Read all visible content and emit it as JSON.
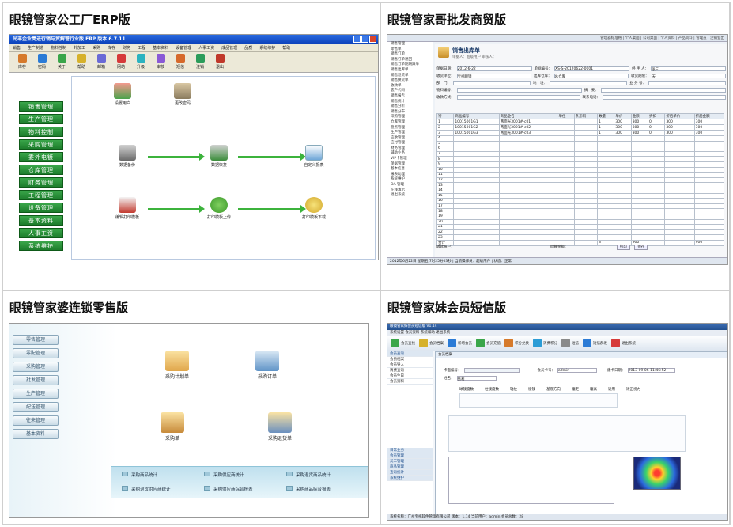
{
  "cells": [
    {
      "title": "眼镜管家公工厂ERP版"
    },
    {
      "title": "眼镜管家哥批发商贸版"
    },
    {
      "title": "眼镜管家婆连锁零售版"
    },
    {
      "title": "眼镜管家妹会员短信版"
    }
  ],
  "erp": {
    "window_title": "光丰企业亮进行销与贸解管行业版 ERP 版本 6.7.11",
    "menu": [
      "销售",
      "生产制造",
      "物料控制",
      "外加工",
      "采购",
      "库存",
      "财务",
      "工程",
      "基本资料",
      "设备管理",
      "人事工资",
      "成品管理",
      "品质",
      "系统维护",
      "帮助"
    ],
    "toolbar": [
      "库存",
      "密码",
      "关于",
      "帮助",
      "邮箱",
      "网站",
      "升级",
      "审核",
      "短信",
      "注销",
      "退出"
    ],
    "side": [
      "销售管理",
      "生产管理",
      "物料控制",
      "采购管理",
      "委外电镀",
      "仓库管理",
      "财务管理",
      "工程管理",
      "设备管理",
      "基本资料",
      "人事工资",
      "系统维护"
    ],
    "nodes": {
      "users": "设置用户",
      "password": "更改密码",
      "backup": "数据备份",
      "restore": "数据恢复",
      "report": "自定义报表",
      "print_template": "编辑打印模板",
      "upload": "打印模板上传",
      "download": "打印模板下载"
    }
  },
  "ws": {
    "topbar": "管理器标准格 | 个人桌面 | 公司桌面 | 个人资料 | 产品资料 | 管理员 | 注销登出",
    "tree": [
      "销售管理",
      "零售单",
      "销售订单",
      "销售订单退回",
      "销售订单期期跟单",
      "销售出库单",
      "销售退货单",
      "销售换货单",
      "收款单",
      "客户代码",
      "销售报告",
      "销售统计",
      "销售分析",
      "销售分布",
      "采购管理",
      "仓库管理",
      "盘点管理",
      "生产管理",
      "应收管理",
      "应付管理",
      "财务管理",
      "辅助业务",
      "VIP卡管理",
      "单据管理",
      "基本信息",
      "报表助理",
      "系统维护",
      "OA 管理",
      "在线演示",
      "退出系统"
    ],
    "form_title": "销售出库单",
    "form_hint": "单据人：超级用户  审核人：",
    "fields": {
      "date_label": "单据日期：",
      "date": "2012-6-22",
      "customer_label": "收货单位：",
      "customer": "宝视眼镜",
      "dept_label": "部　门：",
      "phone_label": "联系电话：",
      "number_label": "单据编号：",
      "number": "XS-S-20120622-0001",
      "warehouse_label": "出库仓库：",
      "warehouse": "总仓库",
      "address_label": "地　址：",
      "memo_label": "摘　要：",
      "handler_label": "经 手 人：",
      "handler": "张三",
      "receive_label": "收货期限：",
      "receive": "天",
      "seller_label": "业 务 号：",
      "type_label": "物料编号：",
      "pay_label": "收款方式："
    },
    "columns": [
      "行",
      "商品编号",
      "商品全名",
      "单位",
      "条形码",
      "数量",
      "单价",
      "金额",
      "折扣",
      "折后单价",
      "折后金额"
    ],
    "rows": [
      [
        "1",
        "10015001G1",
        "两面光3001#-c01",
        "",
        "",
        "1",
        "300",
        "300",
        "0",
        "300",
        "300"
      ],
      [
        "2",
        "10015001G2",
        "两面光3001#-c02",
        "",
        "",
        "1",
        "300",
        "300",
        "0",
        "300",
        "300"
      ],
      [
        "3",
        "10015001G3",
        "两面光3001#-c03",
        "",
        "",
        "1",
        "300",
        "300",
        "0",
        "300",
        "300"
      ],
      [
        "4",
        "",
        "",
        "",
        "",
        "",
        "",
        "",
        "",
        "",
        ""
      ],
      [
        "5",
        "",
        "",
        "",
        "",
        "",
        "",
        "",
        "",
        "",
        ""
      ],
      [
        "6",
        "",
        "",
        "",
        "",
        "",
        "",
        "",
        "",
        "",
        ""
      ],
      [
        "7",
        "",
        "",
        "",
        "",
        "",
        "",
        "",
        "",
        "",
        ""
      ],
      [
        "8",
        "",
        "",
        "",
        "",
        "",
        "",
        "",
        "",
        "",
        ""
      ],
      [
        "9",
        "",
        "",
        "",
        "",
        "",
        "",
        "",
        "",
        "",
        ""
      ],
      [
        "10",
        "",
        "",
        "",
        "",
        "",
        "",
        "",
        "",
        "",
        ""
      ],
      [
        "11",
        "",
        "",
        "",
        "",
        "",
        "",
        "",
        "",
        "",
        ""
      ],
      [
        "12",
        "",
        "",
        "",
        "",
        "",
        "",
        "",
        "",
        "",
        ""
      ],
      [
        "13",
        "",
        "",
        "",
        "",
        "",
        "",
        "",
        "",
        "",
        ""
      ],
      [
        "14",
        "",
        "",
        "",
        "",
        "",
        "",
        "",
        "",
        "",
        ""
      ],
      [
        "15",
        "",
        "",
        "",
        "",
        "",
        "",
        "",
        "",
        "",
        ""
      ],
      [
        "16",
        "",
        "",
        "",
        "",
        "",
        "",
        "",
        "",
        "",
        ""
      ],
      [
        "17",
        "",
        "",
        "",
        "",
        "",
        "",
        "",
        "",
        "",
        ""
      ],
      [
        "18",
        "",
        "",
        "",
        "",
        "",
        "",
        "",
        "",
        "",
        ""
      ],
      [
        "19",
        "",
        "",
        "",
        "",
        "",
        "",
        "",
        "",
        "",
        ""
      ],
      [
        "20",
        "",
        "",
        "",
        "",
        "",
        "",
        "",
        "",
        "",
        ""
      ],
      [
        "21",
        "",
        "",
        "",
        "",
        "",
        "",
        "",
        "",
        "",
        ""
      ],
      [
        "22",
        "",
        "",
        "",
        "",
        "",
        "",
        "",
        "",
        "",
        ""
      ],
      [
        "23",
        "",
        "",
        "",
        "",
        "",
        "",
        "",
        "",
        "",
        ""
      ]
    ],
    "total_label": "合计",
    "total_qty": "3",
    "total_amount": "900",
    "total_after": "900",
    "foot1": "收款账户：",
    "foot2": "结算金额：",
    "btn_print": "打印",
    "btn_save": "保存",
    "status": "2012年6月22日  星期五  7时25分03秒  |  当前操作员：超级用户  |  状态：正常"
  },
  "rt": {
    "side": [
      "零售管理",
      "零配管理",
      "采购管理",
      "批发管理",
      "生产管理",
      "配送管理",
      "往来管理",
      "基本资料"
    ],
    "nodes": {
      "plan": "采购计划单",
      "order": "采购订单",
      "receipt": "采购单",
      "return": "采购退货单"
    },
    "bar": [
      "采购商品统计",
      "采购供应商统计",
      "采购退货商品统计",
      "采购退货供应商统计",
      "采购供应商综合报表",
      "采购商品综合报表"
    ]
  },
  "mb": {
    "window_title": "眼镜管家妹会员短信版  V1.14",
    "menu": "系统设置  会员资料  系统帮助  退出系统",
    "toolbar": [
      "会员查找",
      "会员档案",
      "新增会员",
      "会员充值",
      "积分兑换",
      "消费积分",
      "短信",
      "短信群发",
      "退出系统"
    ],
    "left_top": [
      "会员查询",
      "会员档案",
      "会员导入",
      "消费查询",
      "会员生日",
      "会员资料"
    ],
    "left_bottom": [
      "日常业务",
      "会员管理",
      "员工管理",
      "商品管理",
      "查询统计",
      "系统维护"
    ],
    "tab": "会员档案",
    "member_no_label": "卡面编号：",
    "name_label": "姓名：",
    "name": "张莉",
    "card_label": "会员卡号：",
    "card": "admin",
    "date_label": "建卡日期：",
    "date": "2013-09-06 11:46:52",
    "section_labels": [
      "球镜度数",
      "柱镜度数",
      "轴位",
      "棱镜",
      "基底方向",
      "瞳距",
      "瞳高",
      "近用",
      "矫正视力"
    ],
    "status": "系统名称：广州宝视软件管理有限公司  版本：1.14  当前用户：admin  会员总数：28"
  }
}
